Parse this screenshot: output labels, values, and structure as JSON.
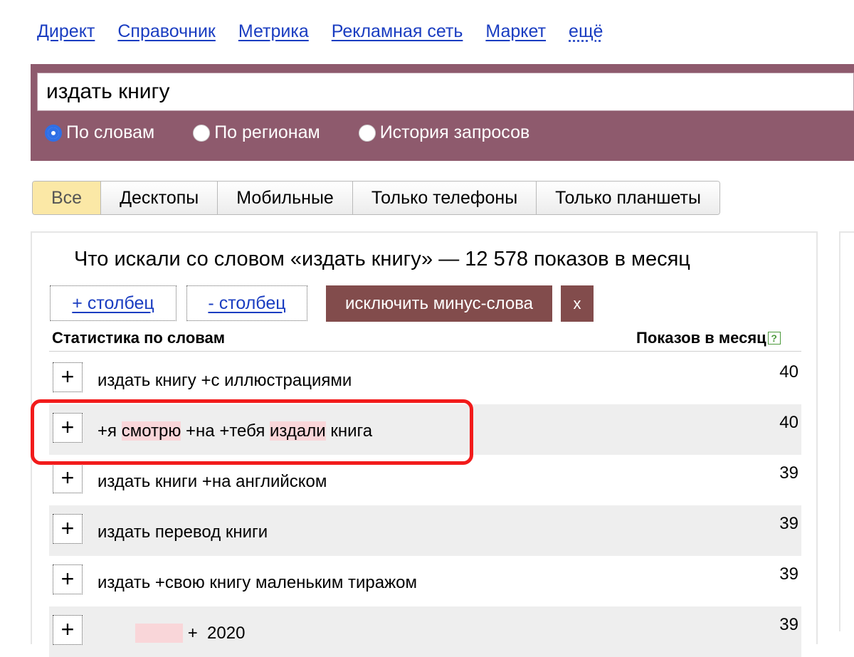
{
  "topnav": {
    "links": [
      "Директ",
      "Справочник",
      "Метрика",
      "Рекламная сеть",
      "Маркет"
    ],
    "more": "ещё"
  },
  "search": {
    "query": "издать книгу",
    "radios": [
      {
        "label": "По словам",
        "selected": true
      },
      {
        "label": "По регионам",
        "selected": false
      },
      {
        "label": "История запросов",
        "selected": false
      }
    ]
  },
  "device_tabs": {
    "items": [
      "Все",
      "Десктопы",
      "Мобильные",
      "Только телефоны",
      "Только планшеты"
    ],
    "active": "Все"
  },
  "stats": {
    "heading": "Что искали со словом «издать книгу» — 12 578 показов в месяц",
    "add_column": "+ столбец",
    "remove_column": "- столбец",
    "exclude_minus": "исключить минус-слова",
    "close": "x",
    "col_words": "Статистика по словам",
    "col_shows": "Показов в месяц",
    "help": "?",
    "plus": "+",
    "rows": [
      {
        "words": [
          "издать книгу +с иллюстрациями"
        ],
        "count": "40"
      },
      {
        "words": [
          "+я ",
          "смотрю",
          " +на +тебя ",
          "издали",
          " книга"
        ],
        "count": "40"
      },
      {
        "words": [
          "издать книги +на английском"
        ],
        "count": "39"
      },
      {
        "words": [
          "издать перевод книги"
        ],
        "count": "39"
      },
      {
        "words": [
          "издать +свою книгу маленьким тиражом"
        ],
        "count": "39"
      },
      {
        "words": [
          "        ",
          "          ",
          " +  2020"
        ],
        "count": "39"
      }
    ]
  },
  "colors": {
    "link": "#1a3dc1",
    "search_bg": "#8e5a6d",
    "button_bg": "#824c4c",
    "highlight": "#f9d6d9",
    "annotation": "#f21b1b"
  }
}
